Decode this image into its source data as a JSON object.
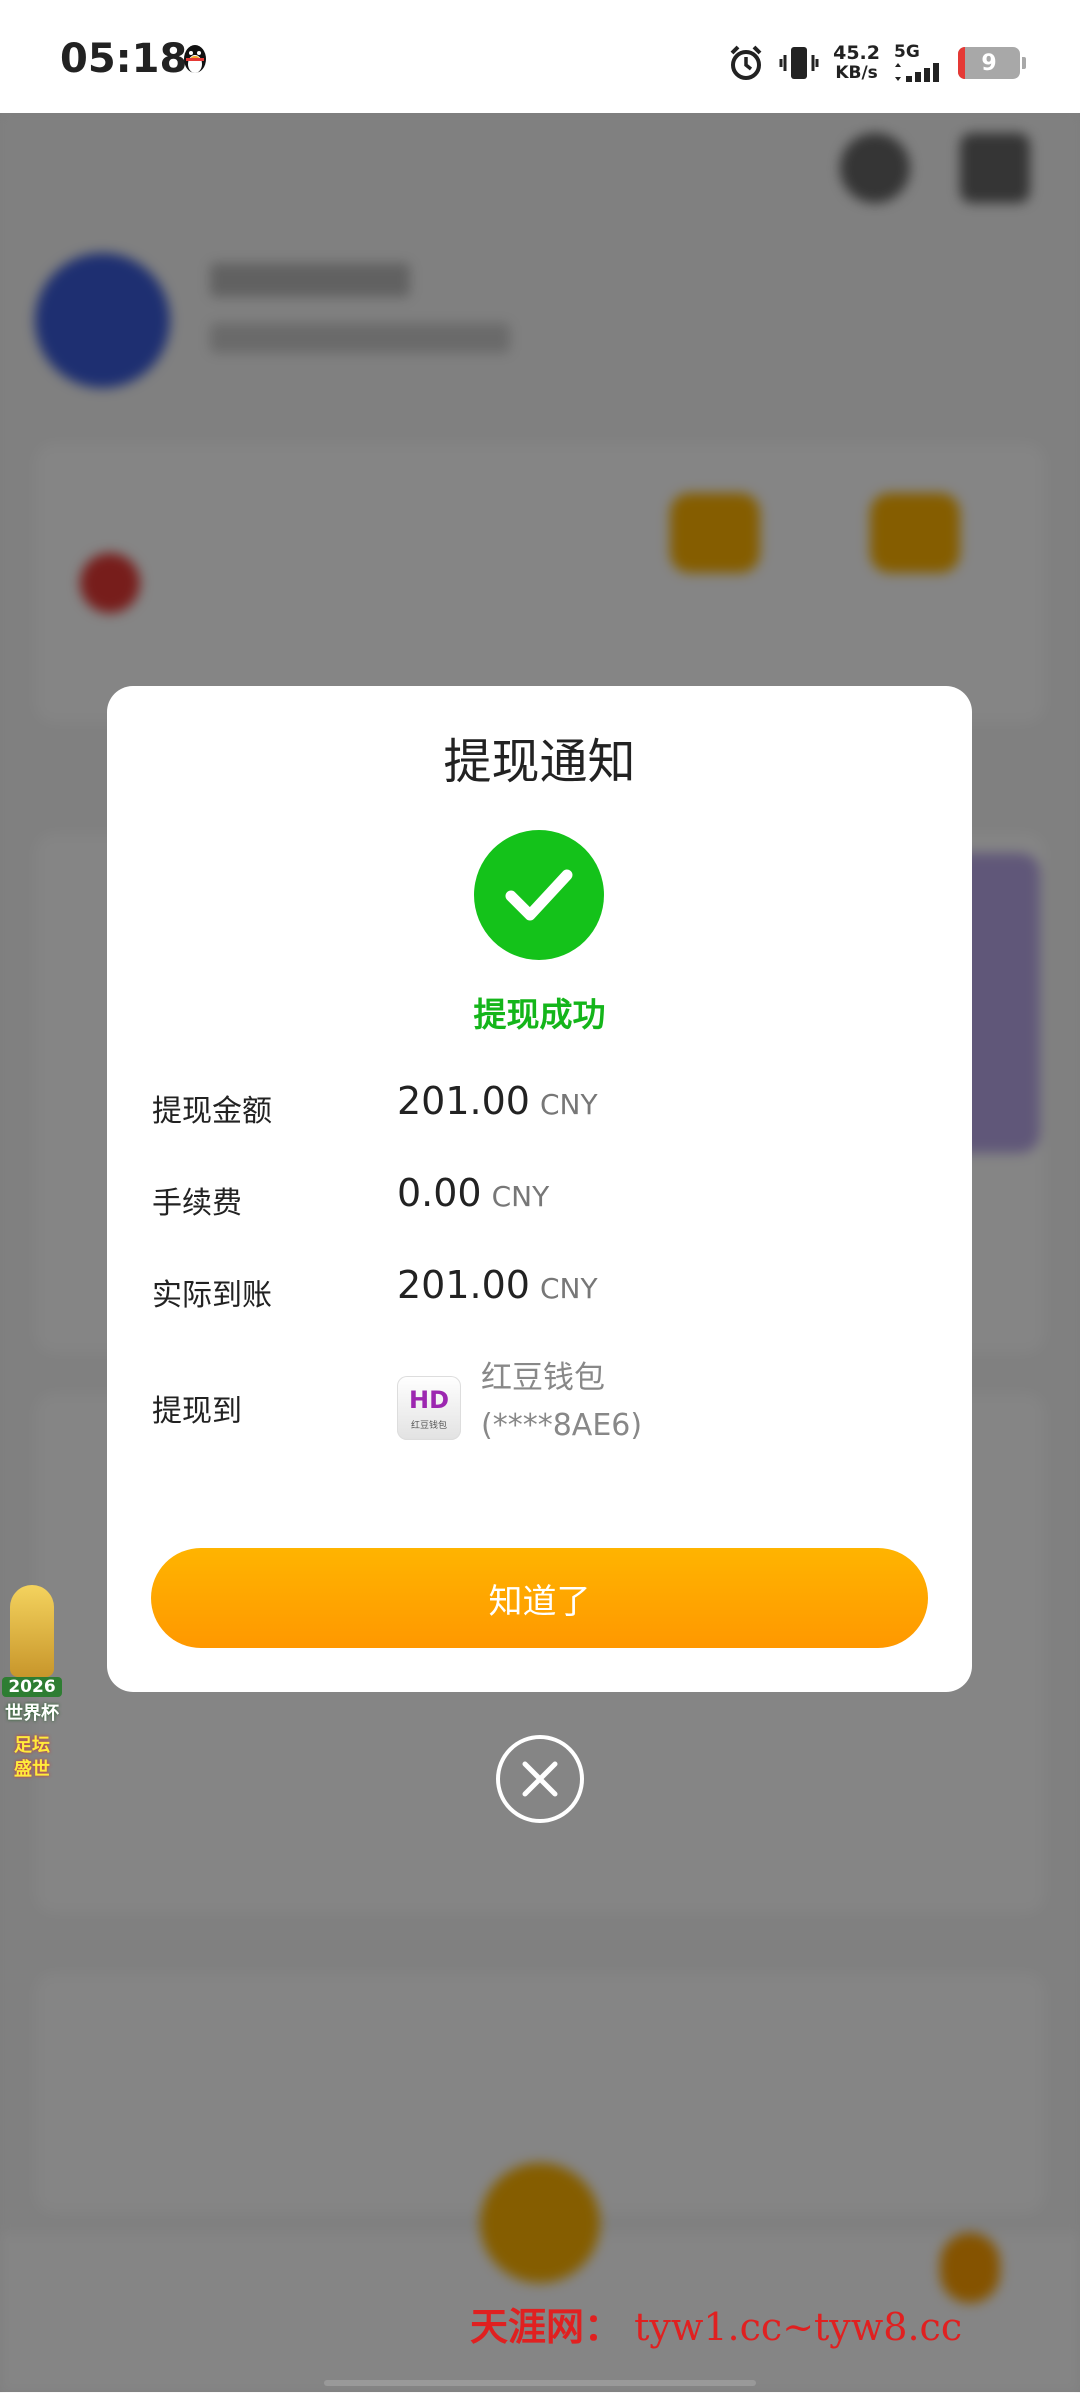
{
  "status_bar": {
    "time": "05:18",
    "net_speed_value": "45.2",
    "net_speed_unit": "KB/s",
    "network_type": "5G",
    "battery_level": "9",
    "icons": [
      "qq-penguin-icon",
      "alarm-icon",
      "vibrate-icon",
      "signal-icon",
      "battery-icon"
    ]
  },
  "modal": {
    "title": "提现通知",
    "success_text": "提现成功",
    "rows": {
      "amount": {
        "label": "提现金额",
        "value": "201.00",
        "unit": "CNY"
      },
      "fee": {
        "label": "手续费",
        "value": "0.00",
        "unit": "CNY"
      },
      "actual": {
        "label": "实际到账",
        "value": "201.00",
        "unit": "CNY"
      },
      "destination": {
        "label": "提现到",
        "wallet_name": "红豆钱包",
        "wallet_account": "(****8AE6)",
        "logo_text": "HD",
        "logo_subtext": "红豆钱包"
      }
    },
    "confirm_label": "知道了"
  },
  "badge": {
    "year": "2026",
    "line1": "世界杯",
    "line2": "足坛",
    "line3": "盛世"
  },
  "watermark": {
    "site_name": "天涯网：",
    "domains": "tyw1.cc~tyw8.cc"
  },
  "colors": {
    "success_green": "#14c21a",
    "button_orange": "#ffa500",
    "watermark_red": "#e02020"
  }
}
